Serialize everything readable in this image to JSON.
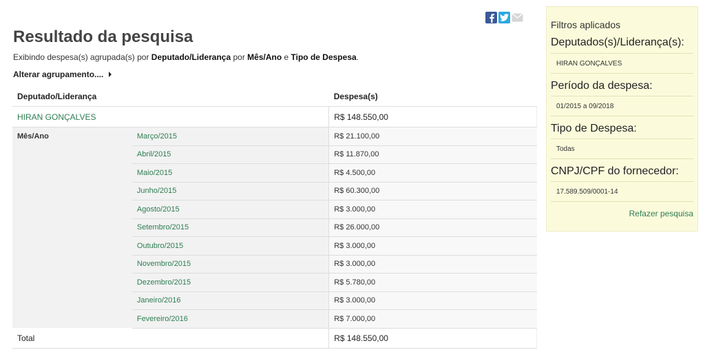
{
  "share": {
    "icons": [
      "facebook-icon",
      "twitter-icon",
      "mail-icon"
    ]
  },
  "page": {
    "title": "Resultado da pesquisa",
    "subtitle": {
      "t1": "Exibindo despesa(s) agrupada(s) por ",
      "b1": "Deputado/Liderança",
      "t2": " por ",
      "b2": "Mês/Ano",
      "t3": " e ",
      "b3": "Tipo de Despesa",
      "t4": "."
    },
    "alterar_label": "Alterar agrupamento...."
  },
  "table": {
    "headers": {
      "deputado": "Deputado/Liderança",
      "despesa": "Despesa(s)"
    },
    "deputado": {
      "name": "HIRAN GONÇALVES",
      "value": "R$ 148.550,00"
    },
    "month_group_label": "Mês/Ano",
    "months": [
      {
        "month": "Março/2015",
        "value": "R$ 21.100,00"
      },
      {
        "month": "Abril/2015",
        "value": "R$ 11.870,00"
      },
      {
        "month": "Maio/2015",
        "value": "R$ 4.500,00"
      },
      {
        "month": "Junho/2015",
        "value": "R$ 60.300,00"
      },
      {
        "month": "Agosto/2015",
        "value": "R$ 3.000,00"
      },
      {
        "month": "Setembro/2015",
        "value": "R$ 26.000,00"
      },
      {
        "month": "Outubro/2015",
        "value": "R$ 3.000,00"
      },
      {
        "month": "Novembro/2015",
        "value": "R$ 3.000,00"
      },
      {
        "month": "Dezembro/2015",
        "value": "R$ 5.780,00"
      },
      {
        "month": "Janeiro/2016",
        "value": "R$ 3.000,00"
      },
      {
        "month": "Fevereiro/2016",
        "value": "R$ 7.000,00"
      }
    ],
    "total": {
      "label": "Total",
      "value": "R$ 148.550,00"
    }
  },
  "sidebar": {
    "title": "Filtros aplicados",
    "deputados_label": "Deputados(s)/Liderança(s):",
    "deputados_value": "HIRAN GONÇALVES",
    "periodo_label": "Período da despesa:",
    "periodo_value": "01/2015 a 09/2018",
    "tipo_label": "Tipo de Despesa:",
    "tipo_value": "Todas",
    "cnpj_label": "CNPJ/CPF do fornecedor:",
    "cnpj_value": "17.589.509/0001-14",
    "refazer_label": "Refazer pesquisa"
  }
}
